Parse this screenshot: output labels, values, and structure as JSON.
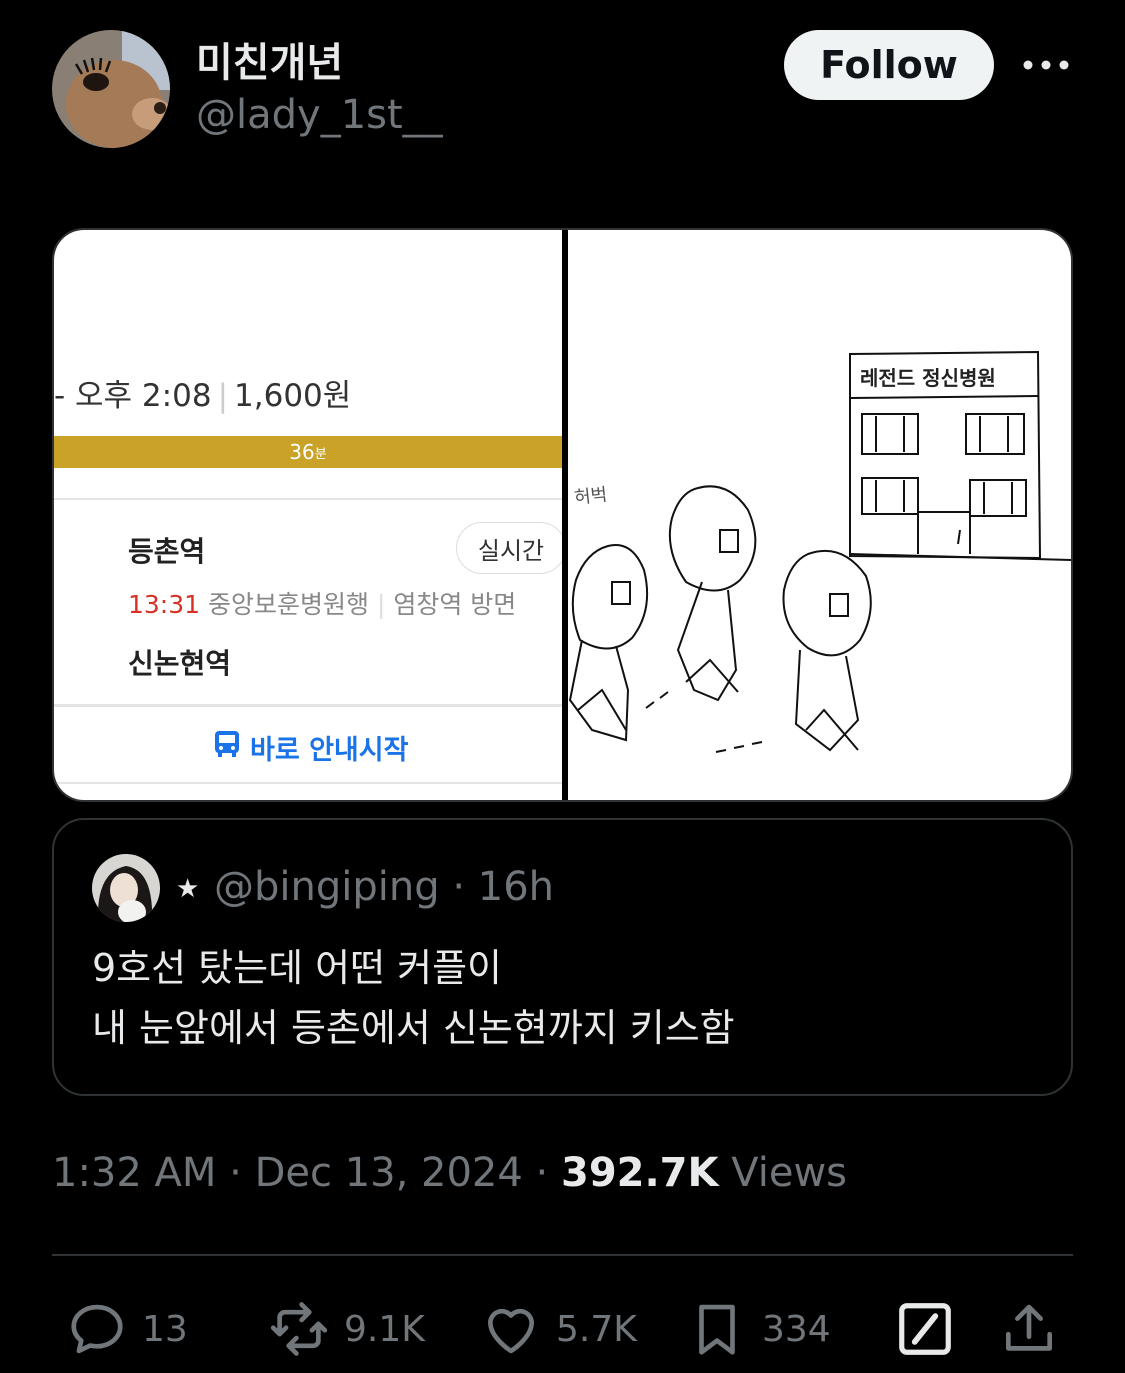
{
  "author": {
    "display_name": "미친개년",
    "handle": "@lady_1st__",
    "avatar": "dog-with-eyelashes-avatar"
  },
  "follow_label": "Follow",
  "more_icon": "more-horizontal-icon",
  "media": {
    "left": {
      "time_range": "- 오후 2:08",
      "fare": "1,600원",
      "duration_value": "36",
      "duration_unit": "분",
      "board_station": "등촌역",
      "realtime_label": "실시간",
      "train_time": "13:31",
      "train_direction": "중앙보훈병원행",
      "train_platform": "염창역 방면",
      "alight_station": "신논현역",
      "guide_label": "바로 안내시작",
      "accent_color": "#c9a227"
    },
    "right": {
      "hospital_sign": "레전드 정신병원",
      "side_text": "허벅"
    }
  },
  "quote": {
    "star": "★",
    "handle": "@bingiping",
    "time": "16h",
    "line1": "9호선 탔는데 어떤 커플이",
    "line2": "내 눈앞에서 등촌에서 신논현까지 키스함"
  },
  "meta": {
    "time": "1:32 AM",
    "date": "Dec 13, 2024",
    "views_count": "392.7K",
    "views_label": "Views"
  },
  "actions": {
    "replies": "13",
    "reposts": "9.1K",
    "likes": "5.7K",
    "bookmarks": "334"
  }
}
